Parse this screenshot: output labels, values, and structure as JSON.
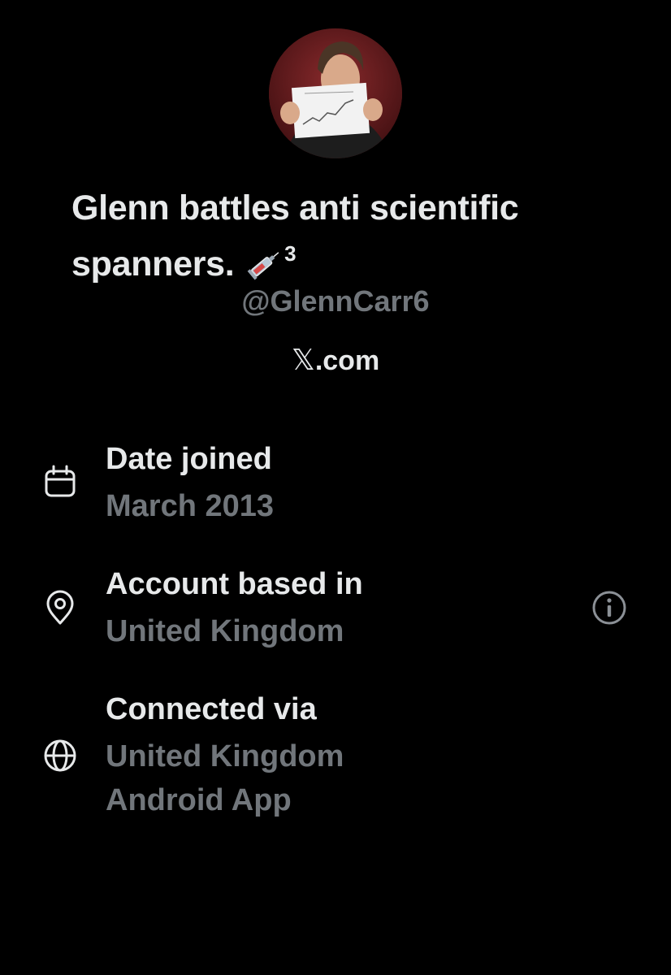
{
  "profile": {
    "display_name": "Glenn battles anti scientific spanners.",
    "emoji_icon": "syringe-icon",
    "superscript": "3",
    "handle": "@GlennCarr6",
    "site_domain": ".com",
    "site_logo": "𝕏"
  },
  "about": {
    "date_joined": {
      "icon": "calendar-icon",
      "label": "Date joined",
      "value": "March 2013"
    },
    "based_in": {
      "icon": "location-pin-icon",
      "label": "Account based in",
      "value": "United Kingdom",
      "info_icon": "info-icon"
    },
    "connected_via": {
      "icon": "globe-icon",
      "label": "Connected via",
      "value_line1": "United Kingdom",
      "value_line2": "Android App"
    }
  },
  "colors": {
    "background": "#000000",
    "primary_text": "#e7e9ea",
    "secondary_text": "#71767b"
  }
}
